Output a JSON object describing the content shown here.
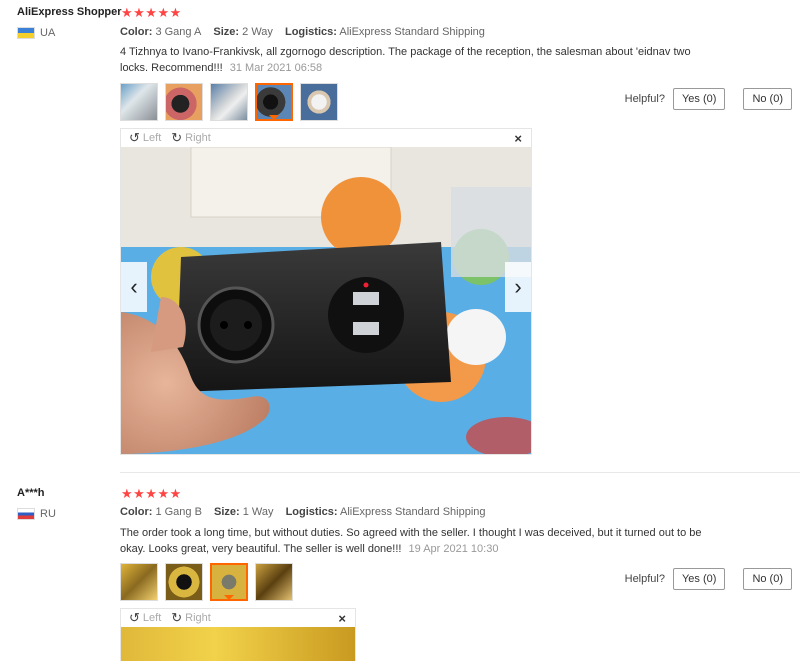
{
  "reviews": [
    {
      "user": "AliExpress Shopper",
      "country": "UA",
      "stars": "★★★★★",
      "color_label": "Color:",
      "color_value": "3 Gang A",
      "size_label": "Size:",
      "size_value": "2 Way",
      "logistics_label": "Logistics:",
      "logistics_value": "AliExpress Standard Shipping",
      "text": "4 Tizhnya to Ivano-Frankivsk, all zgornogo description. The package of the reception, the salesman about 'eidnav two locks. Recommend!!!",
      "date": "31 Mar 2021 06:58",
      "helpful_label": "Helpful?",
      "yes": "Yes (0)",
      "no": "No (0)"
    },
    {
      "user": "A***h",
      "country": "RU",
      "stars": "★★★★★",
      "color_label": "Color:",
      "color_value": "1 Gang B",
      "size_label": "Size:",
      "size_value": "1 Way",
      "logistics_label": "Logistics:",
      "logistics_value": "AliExpress Standard Shipping",
      "text": "The order took a long time, but without duties. So agreed with the seller. I thought I was deceived, but it turned out to be okay. Looks great, very beautiful. The seller is well done!!!",
      "date": "19 Apr 2021 10:30",
      "helpful_label": "Helpful?",
      "yes": "Yes (0)",
      "no": "No (0)"
    }
  ],
  "viewer": {
    "rotate_left": "Left",
    "rotate_right": "Right",
    "close": "×"
  },
  "icons": {
    "rotate_left": "rotate-left-icon",
    "rotate_right": "rotate-right-icon",
    "prev": "chevron-left-icon",
    "next": "chevron-right-icon"
  },
  "colors": {
    "star": "#ff4747",
    "active_thumb": "#ff6600"
  }
}
